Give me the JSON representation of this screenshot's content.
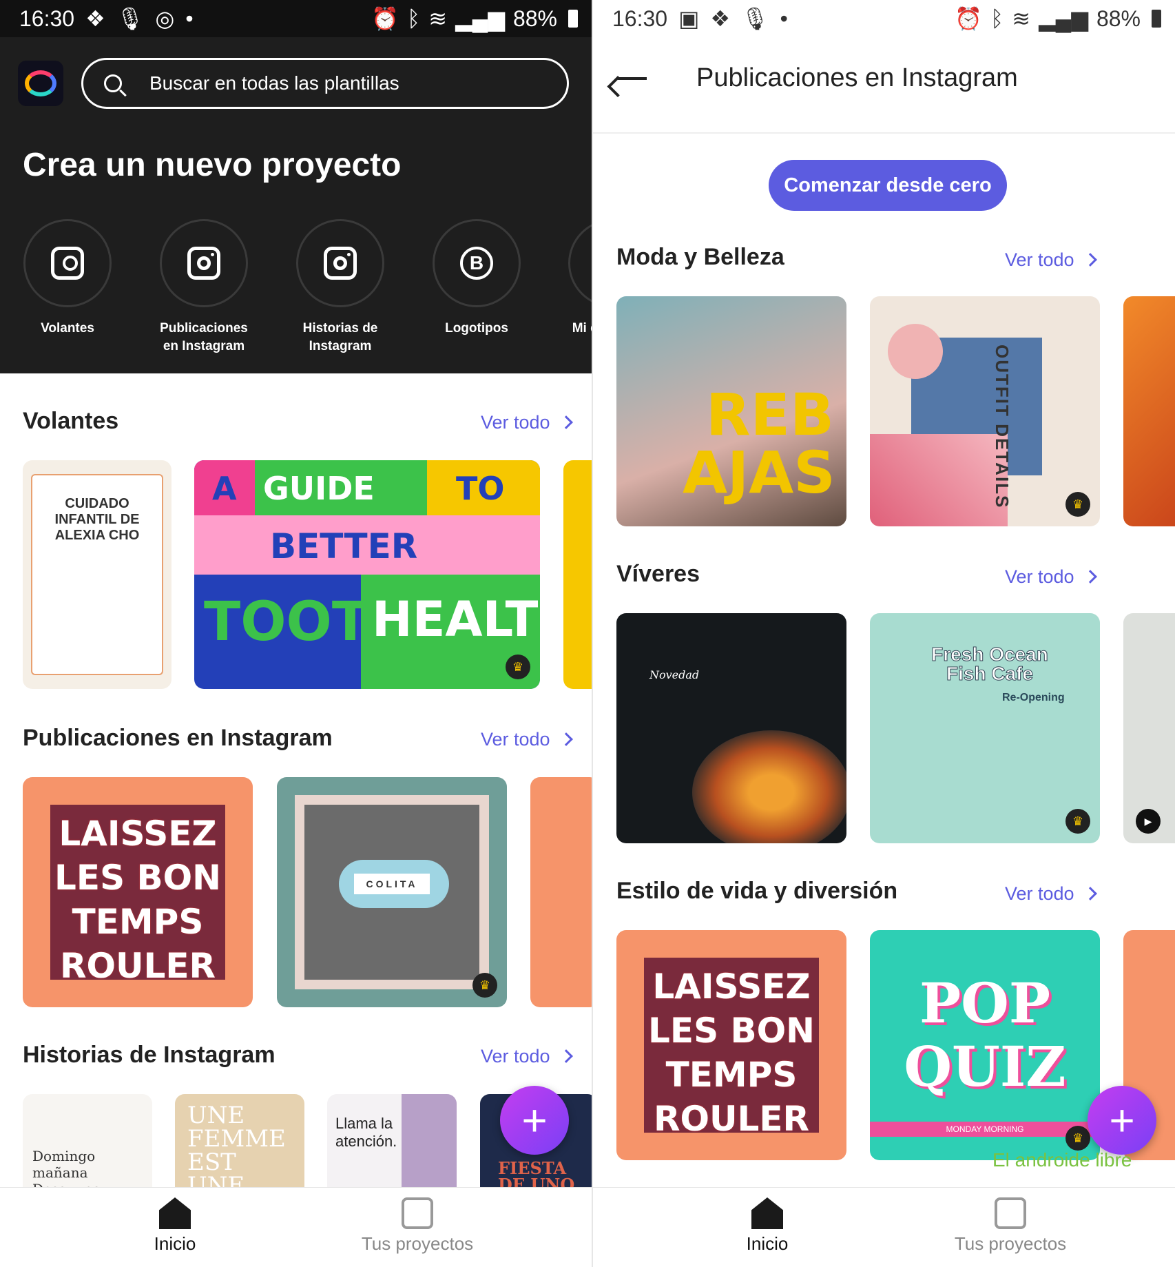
{
  "status": {
    "time": "16:30",
    "battery": "88%"
  },
  "left": {
    "search_placeholder": "Buscar en todas las plantillas",
    "hero_title": "Crea un nuevo proyecto",
    "categories": [
      {
        "label": "Volantes"
      },
      {
        "label": "Publicaciones en Instagram"
      },
      {
        "label": "Historias de Instagram"
      },
      {
        "label": "Logotipos"
      },
      {
        "label": "Mi de"
      }
    ],
    "sections": [
      {
        "title": "Volantes",
        "see_all": "Ver todo"
      },
      {
        "title": "Publicaciones en Instagram",
        "see_all": "Ver todo"
      },
      {
        "title": "Historias de Instagram",
        "see_all": "Ver todo"
      }
    ],
    "cards": {
      "flyer1_title": "CUIDADO INFANTIL DE ALEXIA CHO",
      "flyer2_words": [
        "A",
        "GUIDE",
        "TO",
        "BETTER",
        "TOOTH",
        "HEALTH"
      ],
      "post1": "LAISSEZ LES BON TEMPS ROULER",
      "post2": "COLITA",
      "story1": "Domingo mañana Desayuno",
      "story2": "UNE FEMME EST UNE",
      "story3": "Llama la atención.",
      "story4": "FIESTA DE UNO"
    }
  },
  "right": {
    "title": "Publicaciones en Instagram",
    "start_button": "Comenzar desde cero",
    "sections": [
      {
        "title": "Moda y Belleza",
        "see_all": "Ver todo"
      },
      {
        "title": "Víveres",
        "see_all": "Ver todo"
      },
      {
        "title": "Estilo de vida y diversión",
        "see_all": "Ver todo"
      }
    ],
    "cards": {
      "fashion1": "REB AJAS",
      "fashion2": "OUTFIT DETAILS",
      "food1": "Novedad",
      "food2_title": "Fresh Ocean Fish Cafe",
      "food2_sub": "Re-Opening",
      "life1": "LAISSEZ LES BON TEMPS ROULER",
      "life2": "POP QUIZ",
      "life2_sub": "MONDAY MORNING"
    },
    "watermark": "El androide libre"
  },
  "nav": {
    "home": "Inicio",
    "projects": "Tus proyectos"
  },
  "colors": {
    "accent": "#5c5ce0",
    "dark_bg": "#1e1e1e",
    "fab": "#9b3ff2"
  }
}
